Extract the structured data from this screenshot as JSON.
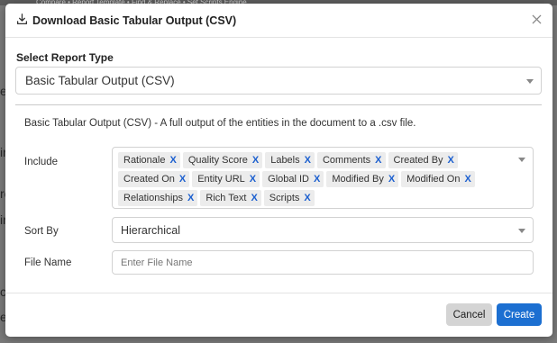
{
  "background": {
    "strip_text": "Compare  •  Report Template  •  Find & Replace  •  Set Scripts Engine",
    "edge_chars": [
      "e",
      "ir",
      "ro",
      "ir",
      "ce",
      "e"
    ]
  },
  "dialog": {
    "title": "Download Basic Tabular Output (CSV)",
    "select_report_label": "Select Report Type",
    "report_type_value": "Basic Tabular Output (CSV)",
    "description": "Basic Tabular Output (CSV)  -  A full output of the entities in the document to a .csv file.",
    "include_label": "Include",
    "include_tags": [
      "Rationale",
      "Quality Score",
      "Labels",
      "Comments",
      "Created By",
      "Created On",
      "Entity URL",
      "Global ID",
      "Modified By",
      "Modified On",
      "Relationships",
      "Rich Text",
      "Scripts"
    ],
    "tag_remove_symbol": "X",
    "sort_by_label": "Sort By",
    "sort_by_value": "Hierarchical",
    "file_name_label": "File Name",
    "file_name_placeholder": "Enter File Name",
    "file_name_value": "",
    "cancel_label": "Cancel",
    "create_label": "Create"
  },
  "colors": {
    "accent": "#1c6fd1",
    "tag_remove": "#1b5fcf",
    "tag_bg": "#ececec",
    "cancel_bg": "#d4d4d4",
    "overlay": "#7a7a7a"
  },
  "icons": {
    "title_icon": "download-icon",
    "close_icon": "close-icon",
    "dropdown_icon": "caret-down-icon"
  }
}
